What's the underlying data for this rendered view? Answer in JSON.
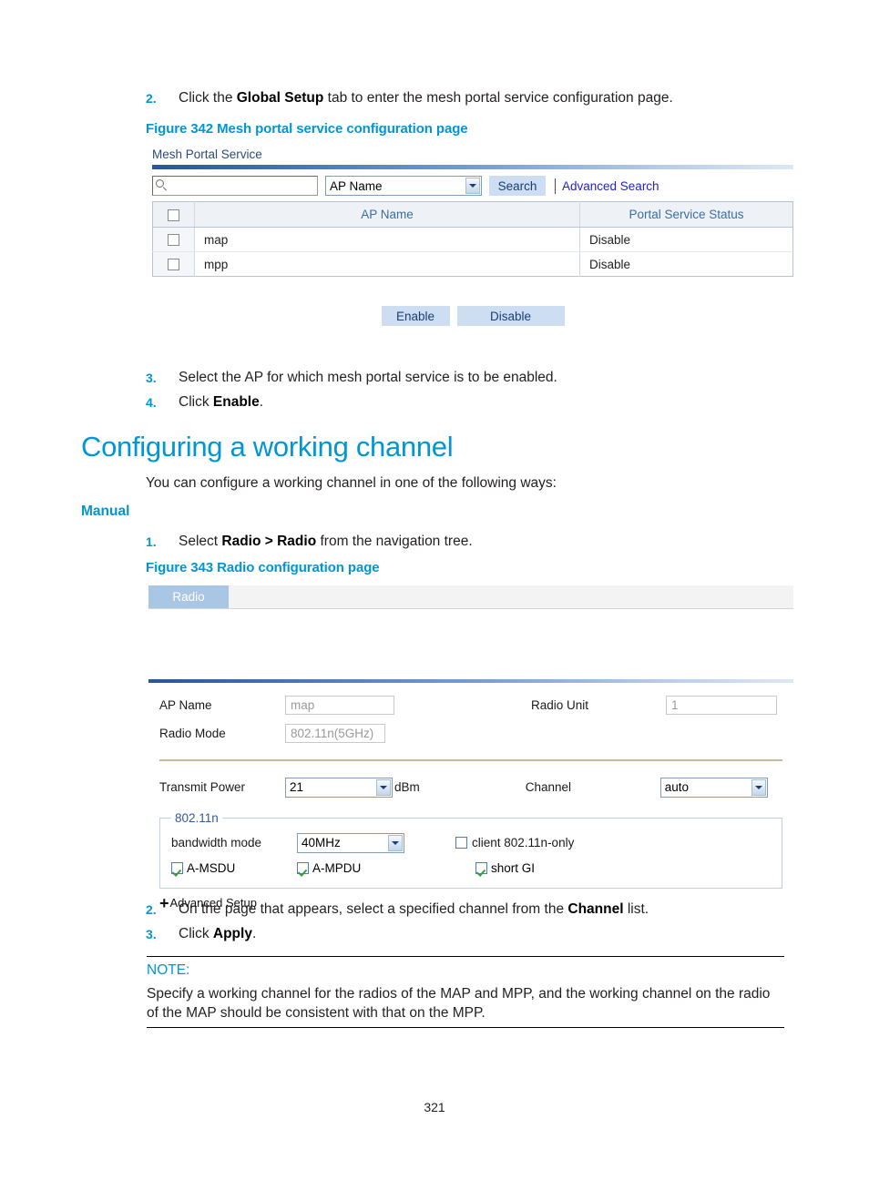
{
  "doc": {
    "page_number": "321",
    "steps_top": [
      {
        "num": "2.",
        "text_before": "Click the ",
        "bold": "Global Setup",
        "text_after": " tab to enter the mesh portal service configuration page."
      }
    ],
    "figure_342_caption": "Figure 342 Mesh portal service configuration page",
    "steps_mid": [
      {
        "num": "3.",
        "text": "Select the AP for which mesh portal service is to be enabled."
      },
      {
        "num": "4.",
        "text_before": "Click ",
        "bold": "Enable",
        "text_after": "."
      }
    ],
    "section_heading": "Configuring a working channel",
    "section_intro": "You can configure a working channel in one of the following ways:",
    "subheading": "Manual",
    "step_radio": {
      "num": "1.",
      "text_before": "Select ",
      "bold": "Radio > Radio",
      "text_after": " from the navigation tree."
    },
    "figure_343_caption": "Figure 343 Radio configuration page",
    "steps_bottom": [
      {
        "num": "2.",
        "text_before": "On the page that appears, select a specified channel from the ",
        "bold": "Channel",
        "text_after": " list."
      },
      {
        "num": "3.",
        "text_before": "Click ",
        "bold": "Apply",
        "text_after": "."
      }
    ],
    "note": {
      "label": "NOTE:",
      "body": "Specify a working channel for the radios of the MAP and MPP, and the working channel on the radio of the MAP should be consistent with that on the MPP."
    }
  },
  "mesh_portal": {
    "panel_title": "Mesh Portal Service",
    "search": {
      "input_value": "",
      "input_placeholder": "",
      "icon": "search-icon",
      "field_select_value": "AP Name",
      "search_button": "Search",
      "advanced_search_link": "Advanced Search"
    },
    "table": {
      "headers": [
        "",
        "AP Name",
        "Portal Service Status"
      ],
      "rows": [
        {
          "checked": false,
          "ap_name": "map",
          "status": "Disable"
        },
        {
          "checked": false,
          "ap_name": "mpp",
          "status": "Disable"
        }
      ]
    },
    "buttons": {
      "enable": "Enable",
      "disable": "Disable"
    }
  },
  "radio_page": {
    "tab_label": "Radio",
    "fields": {
      "ap_name_label": "AP Name",
      "ap_name_value": "map",
      "radio_unit_label": "Radio Unit",
      "radio_unit_value": "1",
      "radio_mode_label": "Radio Mode",
      "radio_mode_value": "802.11n(5GHz)",
      "transmit_power_label": "Transmit Power",
      "transmit_power_value": "21",
      "transmit_power_unit": "dBm",
      "channel_label": "Channel",
      "channel_value": "auto"
    },
    "n_group": {
      "legend": "802.11n",
      "bandwidth_label": "bandwidth mode",
      "bandwidth_value": "40MHz",
      "client_n_only_label": "client 802.11n-only",
      "client_n_only_checked": false,
      "amsdu_label": "A-MSDU",
      "amsdu_checked": true,
      "ampdu_label": "A-MPDU",
      "ampdu_checked": true,
      "short_gi_label": "short GI",
      "short_gi_checked": true
    },
    "advanced_setup_label": "Advanced Setup",
    "advanced_setup_icon": "plus-icon"
  },
  "colors": {
    "accent_blue": "#0096d6",
    "link_blue": "#2222cc",
    "panel_title_blue": "#2b4a7d",
    "button_blue": "#cdddf2",
    "tab_blue": "#a9c6e4",
    "check_green": "#3a9c3a"
  }
}
